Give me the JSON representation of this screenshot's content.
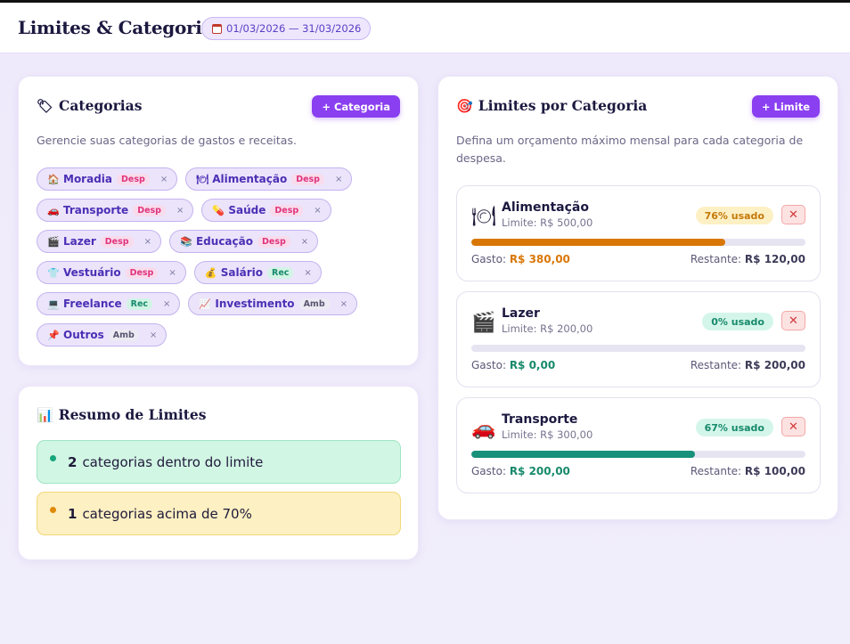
{
  "header": {
    "title": "Limites & Categorias",
    "date_range": "01/03/2026 — 31/03/2026"
  },
  "categories_card": {
    "title": "Categorias",
    "icon": "tag-icon",
    "add_button": "+ Categoria",
    "description": "Gerencie suas categorias de gastos e receitas.",
    "remove_glyph": "×",
    "rows": [
      [
        {
          "icon": "🏠",
          "name": "Moradia",
          "type": "Desp",
          "kind": "desp"
        },
        {
          "icon": "🍽",
          "name": "Alimentação",
          "type": "Desp",
          "kind": "desp"
        }
      ],
      [
        {
          "icon": "🚗",
          "name": "Transporte",
          "type": "Desp",
          "kind": "desp"
        },
        {
          "icon": "💊",
          "name": "Saúde",
          "type": "Desp",
          "kind": "desp"
        }
      ],
      [
        {
          "icon": "🎬",
          "name": "Lazer",
          "type": "Desp",
          "kind": "desp"
        },
        {
          "icon": "📚",
          "name": "Educação",
          "type": "Desp",
          "kind": "desp"
        }
      ],
      [
        {
          "icon": "👕",
          "name": "Vestuário",
          "type": "Desp",
          "kind": "desp"
        },
        {
          "icon": "💰",
          "name": "Salário",
          "type": "Rec",
          "kind": "rec"
        }
      ],
      [
        {
          "icon": "💻",
          "name": "Freelance",
          "type": "Rec",
          "kind": "rec"
        },
        {
          "icon": "📈",
          "name": "Investimento",
          "type": "Amb",
          "kind": "amb"
        }
      ],
      [
        {
          "icon": "📌",
          "name": "Outros",
          "type": "Amb",
          "kind": "amb"
        }
      ]
    ]
  },
  "summary_card": {
    "title": "Resumo de Limites",
    "icon": "bar-chart-icon",
    "within": {
      "count": "2",
      "text": "categorias dentro do limite",
      "color": "#17a57b"
    },
    "above": {
      "count": "1",
      "text": "categorias acima de 70%",
      "color": "#e08a0a"
    }
  },
  "limits_card": {
    "title": "Limites por Categoria",
    "icon": "target-icon",
    "add_button": "+ Limite",
    "description": "Defina um orçamento máximo mensal para cada categoria de despesa.",
    "items": [
      {
        "icon": "🍽",
        "name": "Alimentação",
        "limit": "Limite: R$ 500,00",
        "badge": "76% usado",
        "badge_tone": "amber",
        "progress": 0.76,
        "bar_color": "#d97706",
        "spent_label": "Gasto:",
        "spent": "R$ 380,00",
        "rest_label": "Restante:",
        "rest": "R$ 120,00"
      },
      {
        "icon": "🎬",
        "name": "Lazer",
        "limit": "Limite: R$ 200,00",
        "badge": "0% usado",
        "badge_tone": "green",
        "progress": 0.0,
        "bar_color": "#17917a",
        "spent_label": "Gasto:",
        "spent": "R$ 0,00",
        "rest_label": "Restante:",
        "rest": "R$ 200,00"
      },
      {
        "icon": "🚗",
        "name": "Transporte",
        "limit": "Limite: R$ 300,00",
        "badge": "67% usado",
        "badge_tone": "green",
        "progress": 0.67,
        "bar_color": "#17917a",
        "spent_label": "Gasto:",
        "spent": "R$ 200,00",
        "rest_label": "Restante:",
        "rest": "R$ 100,00"
      }
    ]
  }
}
